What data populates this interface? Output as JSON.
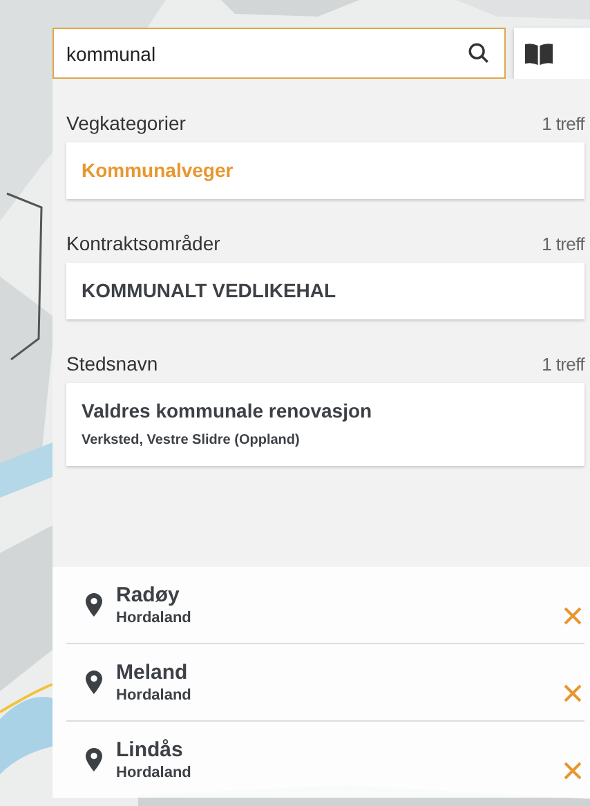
{
  "search": {
    "value": "kommunal"
  },
  "sections": [
    {
      "title": "Vegkategorier",
      "count": "1 treff",
      "results": [
        {
          "title": "Kommunalveger",
          "selected": true
        }
      ]
    },
    {
      "title": "Kontraktsområder",
      "count": "1 treff",
      "results": [
        {
          "title": "KOMMUNALT VEDLIKEHAL",
          "selected": false
        }
      ]
    },
    {
      "title": "Stedsnavn",
      "count": "1 treff",
      "results": [
        {
          "title": "Valdres kommunale renovasjon",
          "subtitle": "Verksted, Vestre Slidre (Oppland)",
          "selected": false
        }
      ]
    }
  ],
  "recent": [
    {
      "name": "Radøy",
      "region": "Hordaland"
    },
    {
      "name": "Meland",
      "region": "Hordaland"
    },
    {
      "name": "Lindås",
      "region": "Hordaland"
    }
  ]
}
